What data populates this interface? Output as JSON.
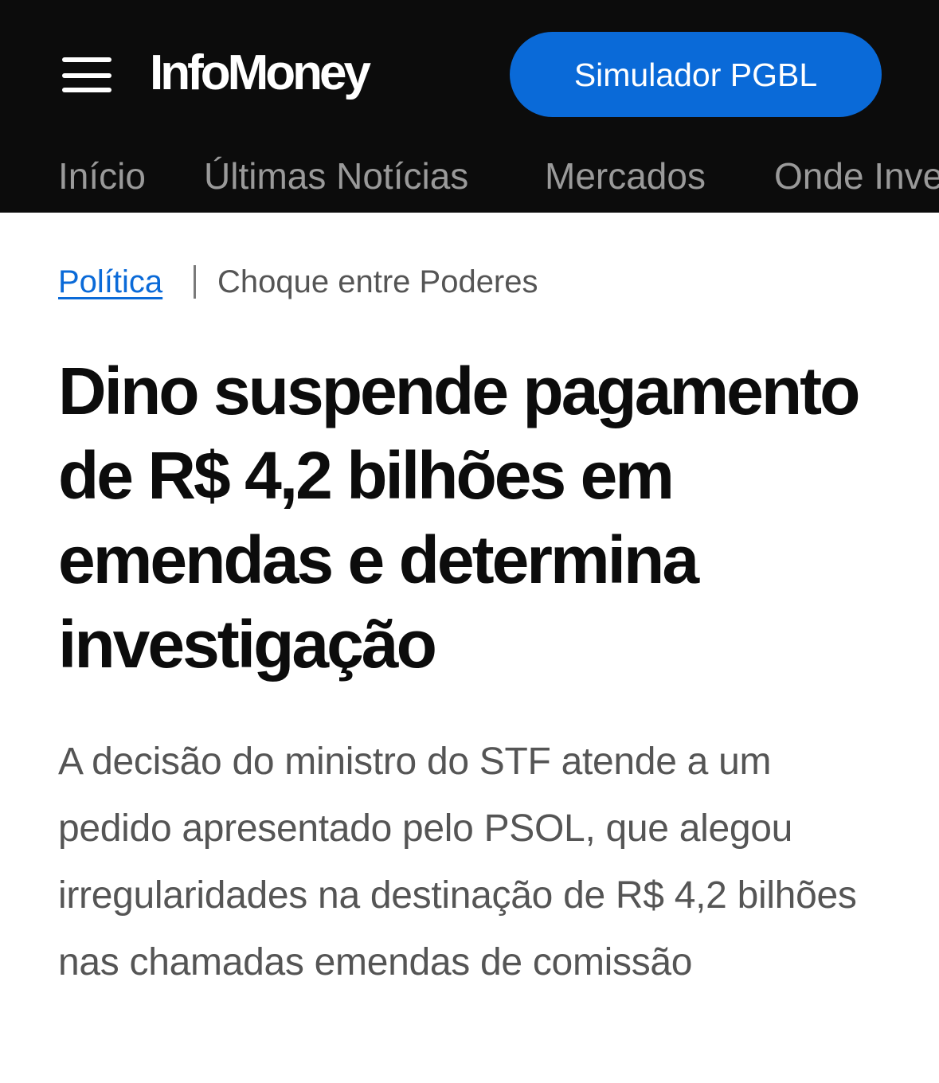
{
  "header": {
    "menu_icon": "hamburger-menu-icon",
    "logo_text": "InfoMoney",
    "cta_label": "Simulador PGBL",
    "colors": {
      "background": "#0c0c0c",
      "cta": "#0a6ad8",
      "nav_text": "#9a9a9a"
    }
  },
  "nav": {
    "items": [
      {
        "label": "Início"
      },
      {
        "label": "Últimas Notícias"
      },
      {
        "label": "Mercados"
      },
      {
        "label": "Onde Investir"
      }
    ]
  },
  "breadcrumb": {
    "section": "Política",
    "topic": "Choque entre Poderes",
    "link_color": "#0a6ad8"
  },
  "article": {
    "headline": "Dino suspende pagamento de R$ 4,2 bilhões em emendas e determina investigação",
    "subtitle": "A decisão do ministro do STF atende a um pedido apresentado pelo PSOL, que alegou irregularidades na destinação de R$ 4,2 bilhões nas chamadas emendas de comissão"
  }
}
